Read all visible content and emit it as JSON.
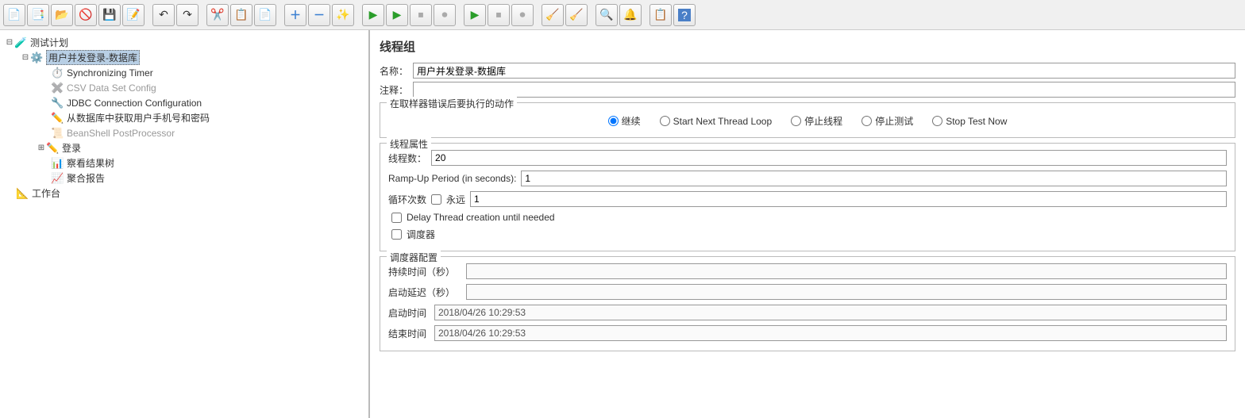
{
  "toolbar": {
    "new": "",
    "templates": "",
    "open": "",
    "close": "",
    "save": "",
    "saveAs": "",
    "cut": "",
    "copy": "",
    "paste": "",
    "expand": "",
    "collapse": "",
    "toggle": "",
    "start": "",
    "startNoPause": "",
    "stop": "",
    "shutdown": "",
    "remoteStart": "",
    "remoteStop": "",
    "remoteShutdown": "",
    "clear": "",
    "clearAll": "",
    "search": "",
    "reset": "",
    "funcHelper": "",
    "help": ""
  },
  "tree": {
    "root": "测试计划",
    "threadGroup": "用户并发登录-数据库",
    "syncTimer": "Synchronizing Timer",
    "csvConfig": "CSV Data Set Config",
    "jdbcConn": "JDBC Connection Configuration",
    "dbQuery": "从数据库中获取用户手机号和密码",
    "beanshell": "BeanShell PostProcessor",
    "login": "登录",
    "viewTree": "察看结果树",
    "aggregate": "聚合报告",
    "workbench": "工作台"
  },
  "panel": {
    "title": "线程组",
    "nameLabel": "名称：",
    "nameValue": "用户并发登录-数据库",
    "commentLabel": "注释：",
    "commentValue": "",
    "samplerErrorGroup": "在取样器错误后要执行的动作",
    "radioContinue": "继续",
    "radioStartNext": "Start Next Thread Loop",
    "radioStopThread": "停止线程",
    "radioStopTest": "停止测试",
    "radioStopNow": "Stop Test Now",
    "threadPropsGroup": "线程属性",
    "threadsLabel": "线程数：",
    "threadsValue": "20",
    "rampLabel": "Ramp-Up Period (in seconds):",
    "rampValue": "1",
    "loopLabel": "循环次数",
    "foreverLabel": "永远",
    "loopValue": "1",
    "delayLabel": "Delay Thread creation until needed",
    "schedulerLabel": "调度器",
    "schedConfigGroup": "调度器配置",
    "durationLabel": "持续时间（秒）",
    "durationValue": "",
    "startupDelayLabel": "启动延迟（秒）",
    "startupDelayValue": "",
    "startTimeLabel": "启动时间",
    "startTimeValue": "2018/04/26 10:29:53",
    "endTimeLabel": "结束时间",
    "endTimeValue": "2018/04/26 10:29:53"
  }
}
